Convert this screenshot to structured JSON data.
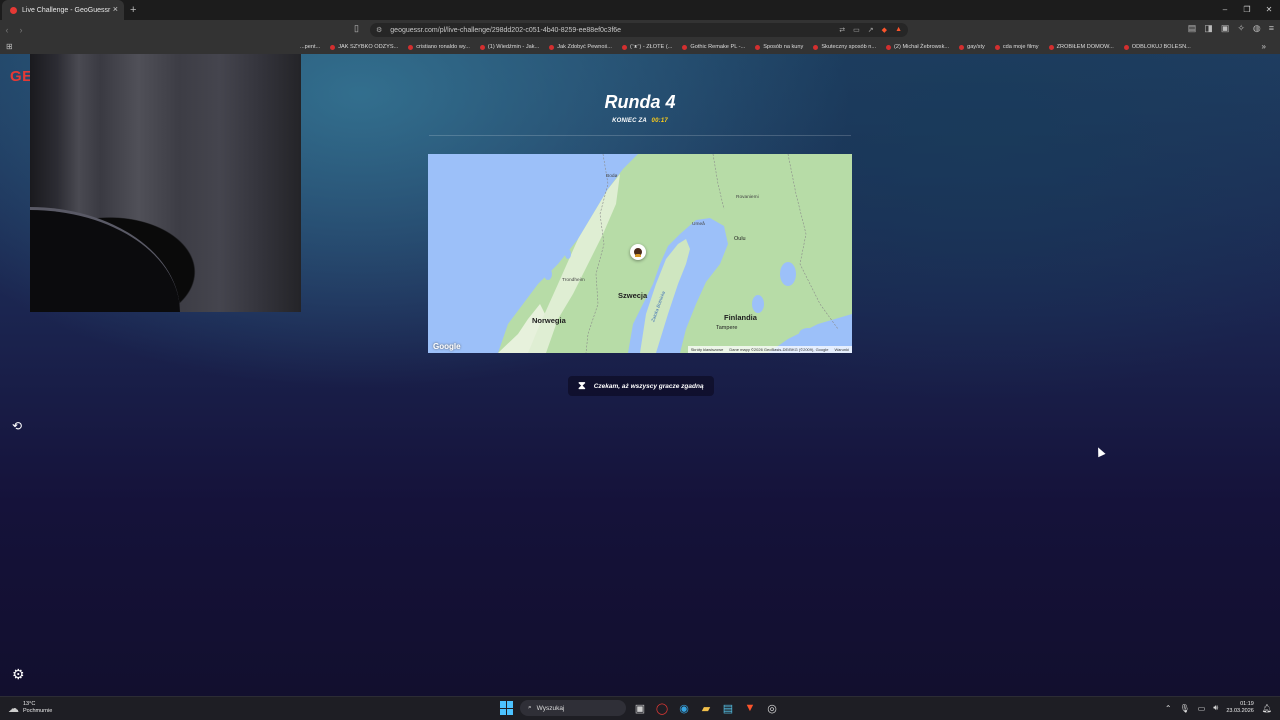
{
  "browser": {
    "tab_title": "Live Challenge - GeoGuessr",
    "tab_close": "×",
    "new_tab": "+",
    "url": "geoguessr.com/pl/live-challenge/298dd202-c051-4b40-8259-ee88ef0c3f6e",
    "window_controls": [
      "–",
      "❐",
      "✕"
    ],
    "bookmarks": [
      "...pent...",
      "JAK SZYBKO ODZYS...",
      "cristiano ronaldo wy...",
      "(1) Wiedźmin - Jak...",
      "Jak Zdobyć Pewnoś...",
      "(ᵔᴥᵔ) - ZŁOTE (...",
      "Gothic Remake PL -...",
      "Sposób na kuny",
      "Skuteczny sposób n...",
      "(2) Michał Żebrowsk...",
      "gay/sty",
      "cda moje filmy",
      "ZROBIŁEM DOMOW...",
      "ODBLOKUJ BOLESN..."
    ],
    "bookmarks_more": "»"
  },
  "game": {
    "logo": "GE",
    "round_title": "Runda 4",
    "timer_label": "KONIEC ZA",
    "timer_value": "00:17",
    "waiting_text": "Czekam, aż wszyscy gracze zgadną"
  },
  "map": {
    "countries": {
      "sweden": "Szwecja",
      "norway": "Norwegia",
      "finland": "Finlandia"
    },
    "cities": {
      "oulu": "Oulu",
      "tampere": "Tampere",
      "trondheim": "Trondheim",
      "rovaniemi": "Rovaniemi",
      "bodo": "Bodø",
      "umea": "Umeå"
    },
    "gulf": "Zatoka Botnicka",
    "google_logo": "Google",
    "footer": [
      "Skróty klawiszowe",
      "Dane mapy ©2026 GeoBasis-DE/BKG (©2009), Google",
      "Warunki"
    ],
    "land_color": "#b7dca7",
    "water_color": "#9cc0f9"
  },
  "taskbar": {
    "temp": "13°C",
    "weather": "Pochmurnie",
    "search_placeholder": "Wyszukaj",
    "time": "01:19",
    "date": "23.03.2026"
  },
  "colors": {
    "accent_yellow": "#fecd19",
    "brand_red": "#e53935"
  }
}
